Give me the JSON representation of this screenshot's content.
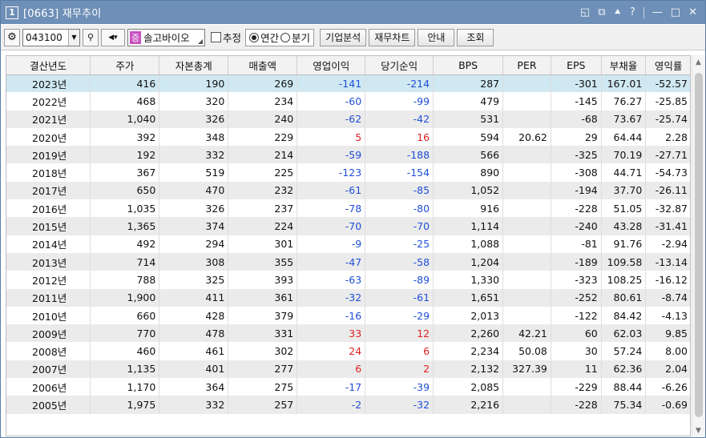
{
  "window": {
    "badge": "1",
    "title": "[0663] 재무추이",
    "controls": [
      "◱",
      "⧉",
      "⯅",
      "?",
      "—",
      "□",
      "✕"
    ]
  },
  "toolbar": {
    "code": "043100",
    "name_tag": "증",
    "name": "솔고바이오",
    "estimate_label": "추정",
    "radio_annual": "연간",
    "radio_quarter": "분기",
    "btn_company": "기업분석",
    "btn_chart": "재무차트",
    "btn_guide": "안내",
    "btn_query": "조회"
  },
  "table": {
    "headers": [
      "결산년도",
      "주가",
      "자본총계",
      "매출액",
      "영업이익",
      "당기순익",
      "BPS",
      "PER",
      "EPS",
      "부채율",
      "영익률"
    ],
    "rows": [
      [
        "2023년",
        "416",
        "190",
        "269",
        "-141",
        "-214",
        "287",
        "",
        "-301",
        "167.01",
        "-52.57"
      ],
      [
        "2022년",
        "468",
        "320",
        "234",
        "-60",
        "-99",
        "479",
        "",
        "-145",
        "76.27",
        "-25.85"
      ],
      [
        "2021년",
        "1,040",
        "326",
        "240",
        "-62",
        "-42",
        "531",
        "",
        "-68",
        "73.67",
        "-25.74"
      ],
      [
        "2020년",
        "392",
        "348",
        "229",
        "5",
        "16",
        "594",
        "20.62",
        "29",
        "64.44",
        "2.28"
      ],
      [
        "2019년",
        "192",
        "332",
        "214",
        "-59",
        "-188",
        "566",
        "",
        "-325",
        "70.19",
        "-27.71"
      ],
      [
        "2018년",
        "367",
        "519",
        "225",
        "-123",
        "-154",
        "890",
        "",
        "-308",
        "44.71",
        "-54.73"
      ],
      [
        "2017년",
        "650",
        "470",
        "232",
        "-61",
        "-85",
        "1,052",
        "",
        "-194",
        "37.70",
        "-26.11"
      ],
      [
        "2016년",
        "1,035",
        "326",
        "237",
        "-78",
        "-80",
        "916",
        "",
        "-228",
        "51.05",
        "-32.87"
      ],
      [
        "2015년",
        "1,365",
        "374",
        "224",
        "-70",
        "-70",
        "1,114",
        "",
        "-240",
        "43.28",
        "-31.41"
      ],
      [
        "2014년",
        "492",
        "294",
        "301",
        "-9",
        "-25",
        "1,088",
        "",
        "-81",
        "91.76",
        "-2.94"
      ],
      [
        "2013년",
        "714",
        "308",
        "355",
        "-47",
        "-58",
        "1,204",
        "",
        "-189",
        "109.58",
        "-13.14"
      ],
      [
        "2012년",
        "788",
        "325",
        "393",
        "-63",
        "-89",
        "1,330",
        "",
        "-323",
        "108.25",
        "-16.12"
      ],
      [
        "2011년",
        "1,900",
        "411",
        "361",
        "-32",
        "-61",
        "1,651",
        "",
        "-252",
        "80.61",
        "-8.74"
      ],
      [
        "2010년",
        "660",
        "428",
        "379",
        "-16",
        "-29",
        "2,013",
        "",
        "-122",
        "84.42",
        "-4.13"
      ],
      [
        "2009년",
        "770",
        "478",
        "331",
        "33",
        "12",
        "2,260",
        "42.21",
        "60",
        "62.03",
        "9.85"
      ],
      [
        "2008년",
        "460",
        "461",
        "302",
        "24",
        "6",
        "2,234",
        "50.08",
        "30",
        "57.24",
        "8.00"
      ],
      [
        "2007년",
        "1,135",
        "401",
        "277",
        "6",
        "2",
        "2,132",
        "327.39",
        "11",
        "62.36",
        "2.04"
      ],
      [
        "2006년",
        "1,170",
        "364",
        "275",
        "-17",
        "-39",
        "2,085",
        "",
        "-229",
        "88.44",
        "-6.26"
      ],
      [
        "2005년",
        "1,975",
        "332",
        "257",
        "-2",
        "-32",
        "2,216",
        "",
        "-228",
        "75.34",
        "-0.69"
      ]
    ]
  },
  "colors": {
    "title_bar": "#6e8fb7",
    "selected_row": "#cfe8f2",
    "negative": "#1f4fd8",
    "positive": "#e02020"
  }
}
